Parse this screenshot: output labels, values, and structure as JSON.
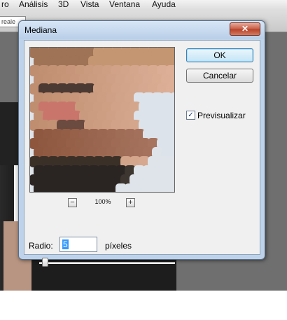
{
  "app": {
    "menu": [
      "ro",
      "Análisis",
      "3D",
      "Vista",
      "Ventana",
      "Ayuda"
    ],
    "options_field": "reale"
  },
  "dialog": {
    "title": "Mediana",
    "close_label": "✕",
    "ok_label": "OK",
    "cancel_label": "Cancelar",
    "preview_checkbox": {
      "label": "Previsualizar",
      "checked": true,
      "mark": "✓"
    },
    "zoom": {
      "minus": "−",
      "plus": "+",
      "level": "100%"
    },
    "radius": {
      "label": "Radio:",
      "value": "5",
      "units": "píxeles"
    },
    "slider_fraction": 0.02
  }
}
